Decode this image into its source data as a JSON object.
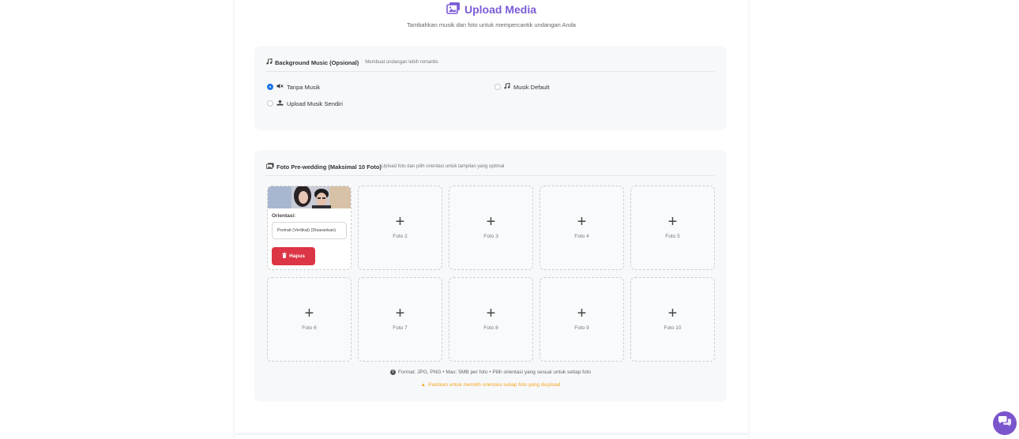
{
  "header": {
    "title": "Upload Media",
    "subtitle": "Tambahkan musik dan foto untuk mempercantik undangan Anda",
    "icon": "images-icon",
    "accent_color": "#7c5cd6"
  },
  "music": {
    "title": "Background Music (Opsional)",
    "description": "Membuat undangan lebih romantis",
    "options": [
      {
        "label": "Tanpa Musik",
        "icon": "volume-mute-icon",
        "selected": true
      },
      {
        "label": "Musik Default",
        "icon": "music-note-icon",
        "selected": false
      },
      {
        "label": "Upload Musik Sendiri",
        "icon": "upload-icon",
        "selected": false
      }
    ]
  },
  "photos": {
    "title": "Foto Pre-wedding (Maksimal 10 Foto)",
    "description": "Upload foto dan pilih orientasi untuk tampilan yang optimal",
    "first": {
      "orientation_label": "Orientasi:",
      "orientation_value": "Portrait (Vertikal) (Disarankan)",
      "delete_label": "Hapus"
    },
    "slots": [
      "Foto 2",
      "Foto 3",
      "Foto 4",
      "Foto 5",
      "Foto 6",
      "Foto 7",
      "Foto 8",
      "Foto 9",
      "Foto 10"
    ],
    "plus": "+",
    "info_note": "Format: JPG, PNG • Max: 5MB per foto • Pilih orientasi yang sesuai untuk setiap foto",
    "warning_note": "Pastikan untuk memilih orientasi setiap foto yang diupload",
    "warning_color": "#f5a623",
    "delete_color": "#dc3545"
  },
  "chat_button": {
    "icon": "chat-bubbles-icon",
    "color": "#7a55cc"
  }
}
